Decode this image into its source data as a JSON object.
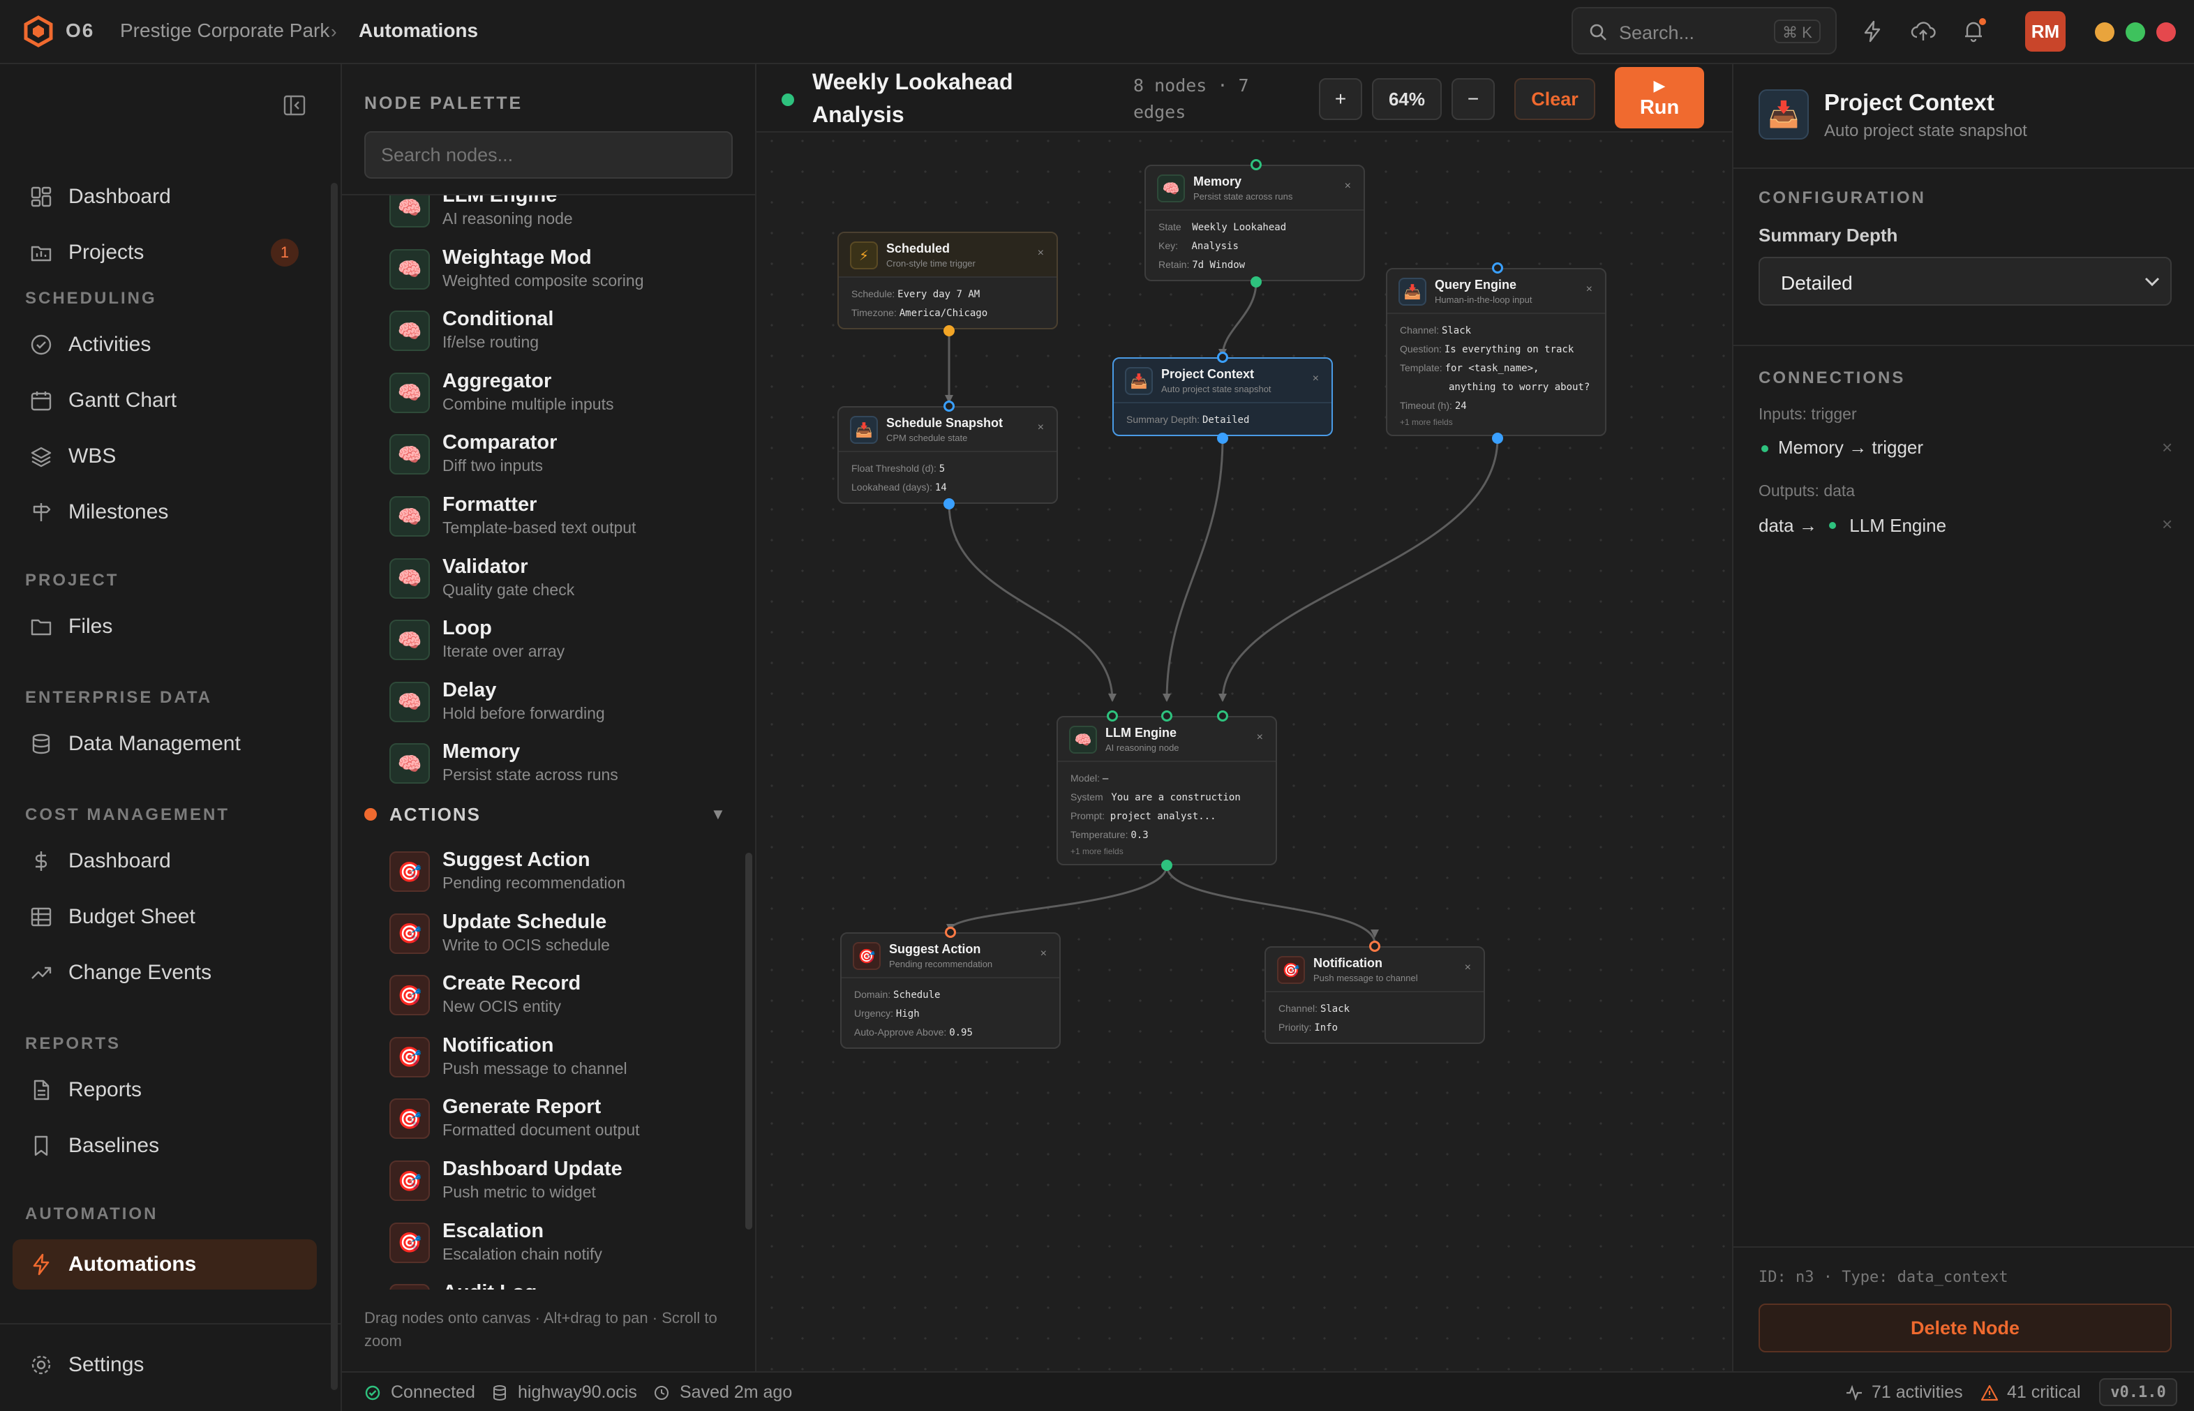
{
  "topbar": {
    "logo": "O6",
    "breadcrumb": [
      "Prestige Corporate Park",
      "Automations"
    ],
    "search_placeholder": "Search...",
    "search_shortcut": "⌘ K",
    "avatar": "RM"
  },
  "sidebar": {
    "main": [
      {
        "label": "Dashboard"
      },
      {
        "label": "Projects",
        "badge": "1"
      }
    ],
    "sections": [
      {
        "title": "SCHEDULING",
        "items": [
          "Activities",
          "Gantt Chart",
          "WBS",
          "Milestones"
        ]
      },
      {
        "title": "PROJECT",
        "items": [
          "Files"
        ]
      },
      {
        "title": "ENTERPRISE DATA",
        "items": [
          "Data Management"
        ]
      },
      {
        "title": "COST MANAGEMENT",
        "items": [
          "Dashboard",
          "Budget Sheet",
          "Change Events"
        ]
      },
      {
        "title": "REPORTS",
        "items": [
          "Reports",
          "Baselines"
        ]
      },
      {
        "title": "AUTOMATION",
        "items": [
          "Automations"
        ]
      }
    ],
    "settings": "Settings"
  },
  "palette": {
    "title": "NODE PALETTE",
    "search_placeholder": "Search nodes...",
    "logic_items": [
      {
        "title": "LLM Engine",
        "sub": "AI reasoning node"
      },
      {
        "title": "Weightage Mod",
        "sub": "Weighted composite scoring"
      },
      {
        "title": "Conditional",
        "sub": "If/else routing"
      },
      {
        "title": "Aggregator",
        "sub": "Combine multiple inputs"
      },
      {
        "title": "Comparator",
        "sub": "Diff two inputs"
      },
      {
        "title": "Formatter",
        "sub": "Template-based text output"
      },
      {
        "title": "Validator",
        "sub": "Quality gate check"
      },
      {
        "title": "Loop",
        "sub": "Iterate over array"
      },
      {
        "title": "Delay",
        "sub": "Hold before forwarding"
      },
      {
        "title": "Memory",
        "sub": "Persist state across runs"
      }
    ],
    "actions_title": "ACTIONS",
    "action_items": [
      {
        "title": "Suggest Action",
        "sub": "Pending recommendation"
      },
      {
        "title": "Update Schedule",
        "sub": "Write to OCIS schedule"
      },
      {
        "title": "Create Record",
        "sub": "New OCIS entity"
      },
      {
        "title": "Notification",
        "sub": "Push message to channel"
      },
      {
        "title": "Generate Report",
        "sub": "Formatted document output"
      },
      {
        "title": "Dashboard Update",
        "sub": "Push metric to widget"
      },
      {
        "title": "Escalation",
        "sub": "Escalation chain notify"
      },
      {
        "title": "Audit Log",
        "sub": ""
      }
    ],
    "footer": "Drag nodes onto canvas · Alt+drag to pan · Scroll to zoom"
  },
  "toolbar": {
    "workflow_name": "Weekly Lookahead Analysis",
    "stats": "8 nodes · 7 edges",
    "zoom_in": "+",
    "zoom": "64%",
    "zoom_out": "−",
    "clear": "Clear",
    "run": "Run"
  },
  "nodes": {
    "scheduled": {
      "title": "Scheduled",
      "sub": "Cron-style time trigger",
      "fields": [
        [
          "Schedule:",
          "Every day 7 AM"
        ],
        [
          "Timezone:",
          "America/Chicago"
        ]
      ]
    },
    "memory": {
      "title": "Memory",
      "sub": "Persist state across runs",
      "fields": [
        [
          "State",
          "Weekly Lookahead"
        ],
        [
          "Key:",
          "Analysis"
        ],
        [
          "Retain:",
          "7d Window"
        ]
      ]
    },
    "query": {
      "title": "Query Engine",
      "sub": "Human-in-the-loop input",
      "fields": [
        [
          "Channel:",
          "Slack"
        ],
        [
          "Question:",
          "Is everything on track"
        ],
        [
          "Template:",
          "for <task_name>,"
        ],
        [
          "",
          "anything to worry about?"
        ],
        [
          "Timeout (h):",
          "24"
        ]
      ],
      "more": "+1 more fields"
    },
    "snapshot": {
      "title": "Schedule Snapshot",
      "sub": "CPM schedule state",
      "fields": [
        [
          "Float Threshold (d):",
          "5"
        ],
        [
          "Lookahead (days):",
          "14"
        ]
      ]
    },
    "context": {
      "title": "Project Context",
      "sub": "Auto project state snapshot",
      "fields": [
        [
          "Summary Depth:",
          "Detailed"
        ]
      ]
    },
    "llm": {
      "title": "LLM Engine",
      "sub": "AI reasoning node",
      "fields": [
        [
          "Model:",
          "—"
        ],
        [
          "System",
          "You are a construction"
        ],
        [
          "Prompt:",
          "project analyst..."
        ],
        [
          "Temperature:",
          "0.3"
        ]
      ],
      "more": "+1 more fields"
    },
    "suggest": {
      "title": "Suggest Action",
      "sub": "Pending recommendation",
      "fields": [
        [
          "Domain:",
          "Schedule"
        ],
        [
          "Urgency:",
          "High"
        ],
        [
          "Auto-Approve Above:",
          "0.95"
        ]
      ]
    },
    "notification": {
      "title": "Notification",
      "sub": "Push message to channel",
      "fields": [
        [
          "Channel:",
          "Slack"
        ],
        [
          "Priority:",
          "Info"
        ]
      ]
    }
  },
  "inspector": {
    "title": "Project Context",
    "subtitle": "Auto project state snapshot",
    "config_header": "CONFIGURATION",
    "summary_label": "Summary Depth",
    "summary_value": "Detailed",
    "connections_header": "CONNECTIONS",
    "inputs_label": "Inputs: trigger",
    "input_conn": "Memory → trigger",
    "outputs_label": "Outputs: data",
    "output_conn_prefix": "data →",
    "output_conn_target": "LLM Engine",
    "node_id": "ID: n3 · Type: data_context",
    "delete": "Delete Node"
  },
  "status": {
    "connected": "Connected",
    "host": "highway90.ocis",
    "saved": "Saved 2m ago",
    "activities": "71 activities",
    "critical": "41 critical",
    "version": "v0.1.0"
  },
  "colors": {
    "accent": "#f06a2f",
    "selected": "#4a9be6",
    "success": "#2ec27e"
  }
}
